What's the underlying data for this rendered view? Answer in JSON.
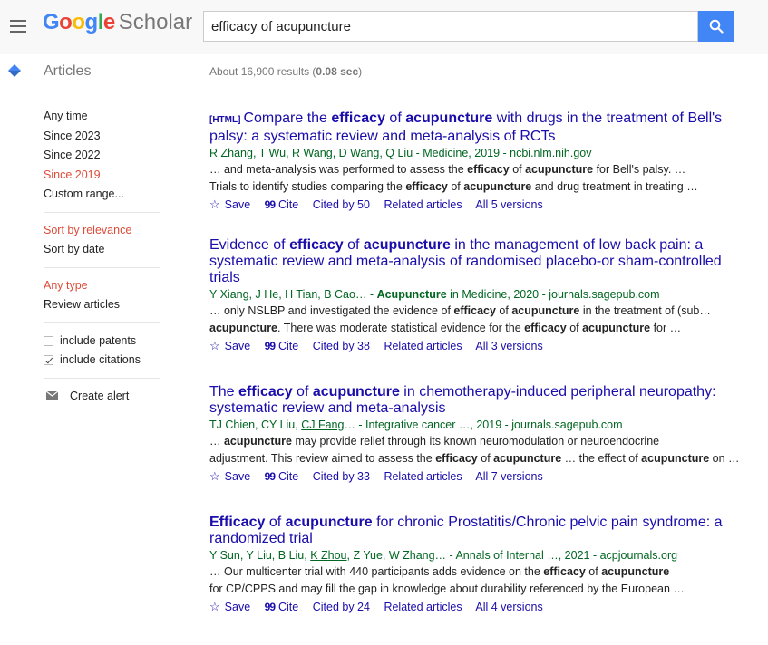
{
  "header": {
    "logo": {
      "letters": [
        "G",
        "o",
        "o",
        "g",
        "l",
        "e"
      ],
      "product": "Scholar"
    },
    "search": {
      "value": "efficacy of acupuncture",
      "placeholder": ""
    },
    "search_button_icon": "search-icon"
  },
  "subheader": {
    "section_label": "Articles",
    "results_prefix": "About 16,900 results (",
    "results_time": "0.08 sec",
    "results_suffix": ")"
  },
  "sidebar": {
    "time_filters": [
      {
        "label": "Any time",
        "active": false
      },
      {
        "label": "Since 2023",
        "active": false
      },
      {
        "label": "Since 2022",
        "active": false
      },
      {
        "label": "Since 2019",
        "active": true
      },
      {
        "label": "Custom range...",
        "active": false
      }
    ],
    "sort_options": [
      {
        "label": "Sort by relevance",
        "active": true
      },
      {
        "label": "Sort by date",
        "active": false
      }
    ],
    "type_filters": [
      {
        "label": "Any type",
        "active": true
      },
      {
        "label": "Review articles",
        "active": false
      }
    ],
    "checkboxes": [
      {
        "label": "include patents",
        "checked": false
      },
      {
        "label": "include citations",
        "checked": true
      }
    ],
    "create_alert": "Create alert"
  },
  "results": [
    {
      "tag": "[HTML]",
      "title_parts": [
        [
          "Compare the ",
          false
        ],
        [
          "efficacy",
          true
        ],
        [
          " of ",
          false
        ],
        [
          "acupuncture",
          true
        ],
        [
          " with drugs in the treatment of Bell's palsy: a systematic review and meta-analysis of RCTs",
          false
        ]
      ],
      "authors_parts": [
        [
          "R Zhang, T Wu, R Wang, D Wang, Q Liu - Medicine, 2019 - ncbi.nlm.nih.gov",
          false
        ]
      ],
      "snippet_lines": [
        [
          [
            "… and meta-analysis was performed to assess the ",
            false
          ],
          [
            "efficacy",
            true
          ],
          [
            " of ",
            false
          ],
          [
            "acupuncture",
            true
          ],
          [
            " for Bell's palsy. …",
            false
          ]
        ],
        [
          [
            "Trials to identify studies comparing the ",
            false
          ],
          [
            "efficacy",
            true
          ],
          [
            " of ",
            false
          ],
          [
            "acupuncture",
            true
          ],
          [
            " and drug treatment in treating …",
            false
          ]
        ]
      ],
      "actions": {
        "save": "Save",
        "cite": "Cite",
        "cited_by": "Cited by 50",
        "related": "Related articles",
        "versions": "All 5 versions"
      }
    },
    {
      "tag": "",
      "title_parts": [
        [
          "Evidence of ",
          false
        ],
        [
          "efficacy",
          true
        ],
        [
          " of ",
          false
        ],
        [
          "acupuncture",
          true
        ],
        [
          " in the management of low back pain: a systematic review and meta-analysis of randomised placebo-or sham-controlled trials",
          false
        ]
      ],
      "authors_parts": [
        [
          "Y Xiang, J He, H Tian, B Cao… - ",
          false
        ],
        [
          "Acupuncture",
          "bold"
        ],
        [
          " in Medicine, 2020 - journals.sagepub.com",
          false
        ]
      ],
      "snippet_lines": [
        [
          [
            "… only NSLBP and investigated the evidence of ",
            false
          ],
          [
            "efficacy",
            true
          ],
          [
            " of ",
            false
          ],
          [
            "acupuncture",
            true
          ],
          [
            " in the treatment of (sub…",
            false
          ]
        ],
        [
          [
            "acupuncture",
            true
          ],
          [
            ". There was moderate statistical evidence for the ",
            false
          ],
          [
            "efficacy",
            true
          ],
          [
            " of ",
            false
          ],
          [
            "acupuncture",
            true
          ],
          [
            " for …",
            false
          ]
        ]
      ],
      "actions": {
        "save": "Save",
        "cite": "Cite",
        "cited_by": "Cited by 38",
        "related": "Related articles",
        "versions": "All 3 versions"
      }
    },
    {
      "tag": "",
      "title_parts": [
        [
          "The ",
          false
        ],
        [
          "efficacy",
          true
        ],
        [
          " of ",
          false
        ],
        [
          "acupuncture",
          true
        ],
        [
          " in chemotherapy-induced peripheral neuropathy: systematic review and meta-analysis",
          false
        ]
      ],
      "authors_parts": [
        [
          "TJ Chien, CY Liu, ",
          false
        ],
        [
          "CJ Fang",
          "link"
        ],
        [
          "… - Integrative cancer …, 2019 - journals.sagepub.com",
          false
        ]
      ],
      "snippet_lines": [
        [
          [
            "… ",
            false
          ],
          [
            "acupuncture",
            true
          ],
          [
            " may provide relief through its known neuromodulation or neuroendocrine",
            false
          ]
        ],
        [
          [
            "adjustment. This review aimed to assess the ",
            false
          ],
          [
            "efficacy",
            true
          ],
          [
            " of ",
            false
          ],
          [
            "acupuncture",
            true
          ],
          [
            " … the effect of ",
            false
          ],
          [
            "acupuncture",
            true
          ],
          [
            " on …",
            false
          ]
        ]
      ],
      "actions": {
        "save": "Save",
        "cite": "Cite",
        "cited_by": "Cited by 33",
        "related": "Related articles",
        "versions": "All 7 versions"
      }
    },
    {
      "tag": "",
      "title_parts": [
        [
          "Efficacy",
          true
        ],
        [
          " of ",
          false
        ],
        [
          "acupuncture",
          true
        ],
        [
          " for chronic Prostatitis/Chronic pelvic pain syndrome: a randomized trial",
          false
        ]
      ],
      "authors_parts": [
        [
          "Y Sun, Y Liu, B Liu, ",
          false
        ],
        [
          "K Zhou",
          "link"
        ],
        [
          ", Z Yue, W Zhang… - Annals of Internal …, 2021 - acpjournals.org",
          false
        ]
      ],
      "snippet_lines": [
        [
          [
            "… Our multicenter trial with 440 participants adds evidence on the ",
            false
          ],
          [
            "efficacy",
            true
          ],
          [
            " of ",
            false
          ],
          [
            "acupuncture",
            true
          ]
        ],
        [
          [
            "for CP/CPPS and may fill the gap in knowledge about durability referenced by the European …",
            false
          ]
        ]
      ],
      "actions": {
        "save": "Save",
        "cite": "Cite",
        "cited_by": "Cited by 24",
        "related": "Related articles",
        "versions": "All 4 versions"
      }
    }
  ],
  "colors": {
    "link": "#1a0dab",
    "green": "#006621",
    "active": "#dd4b39",
    "search_button": "#4285f4"
  }
}
